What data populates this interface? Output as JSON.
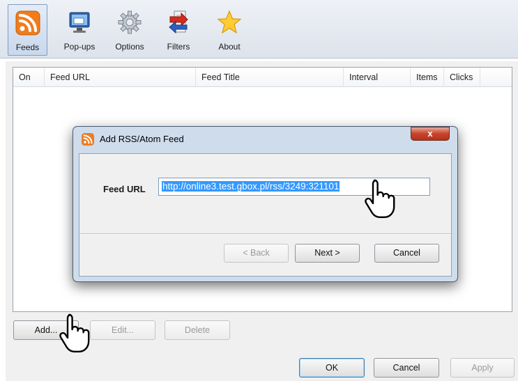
{
  "toolbar": {
    "items": [
      {
        "label": "Feeds",
        "icon": "rss-icon",
        "active": true
      },
      {
        "label": "Pop-ups",
        "icon": "monitor-icon"
      },
      {
        "label": "Options",
        "icon": "gear-icon"
      },
      {
        "label": "Filters",
        "icon": "filter-arrows-icon"
      },
      {
        "label": "About",
        "icon": "star-icon"
      }
    ]
  },
  "table": {
    "columns": [
      "On",
      "Feed URL",
      "Feed Title",
      "Interval",
      "Items",
      "Clicks"
    ]
  },
  "list_buttons": {
    "add": "Add...",
    "edit": "Edit...",
    "delete": "Delete"
  },
  "footer_buttons": {
    "ok": "OK",
    "cancel": "Cancel",
    "apply": "Apply"
  },
  "dialog": {
    "title": "Add RSS/Atom Feed",
    "close": "x",
    "feed_url_label": "Feed URL",
    "feed_url_value": "http://online3.test.gbox.pl/rss/3249:321101",
    "back": "< Back",
    "next": "Next >",
    "cancel": "Cancel"
  },
  "colors": {
    "accent": "#3399ff",
    "rss_orange": "#f07c1c",
    "close_red": "#c9432b"
  }
}
